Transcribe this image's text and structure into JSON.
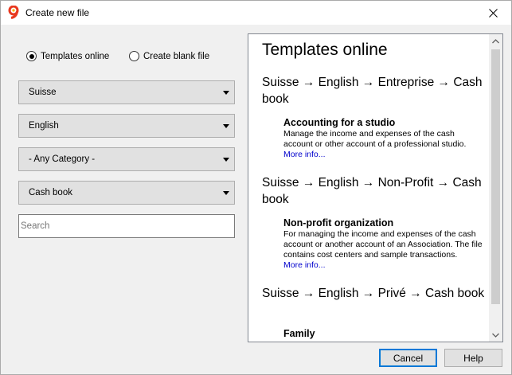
{
  "window": {
    "title": "Create new file"
  },
  "mode": {
    "templates_online_label": "Templates online",
    "blank_file_label": "Create blank file",
    "selected": "templates_online"
  },
  "filters": {
    "country": "Suisse",
    "language": "English",
    "category": "- Any Category -",
    "type": "Cash book"
  },
  "search": {
    "placeholder": "Search",
    "value": ""
  },
  "browser": {
    "heading": "Templates online",
    "groups": [
      {
        "path": "Suisse → English → Entreprise → Cash book",
        "template": {
          "title": "Accounting for a studio",
          "description": "Manage the income and expenses of the cash account or other account of a professional studio.",
          "link": "More info..."
        }
      },
      {
        "path": "Suisse → English → Non-Profit → Cash book",
        "template": {
          "title": "Non-profit organization",
          "description": "For managing the income and expenses of the cash account or another account of an Association. The file contains cost centers and sample transactions.",
          "link": "More info..."
        }
      },
      {
        "path": "Suisse → English → Privé → Cash book",
        "template": {
          "title": "Family",
          "description": "",
          "link": ""
        }
      }
    ]
  },
  "buttons": {
    "cancel": "Cancel",
    "help": "Help"
  },
  "colors": {
    "default_button_border": "#0078d7",
    "link": "#0000cc",
    "app_icon": "#e8381f"
  }
}
